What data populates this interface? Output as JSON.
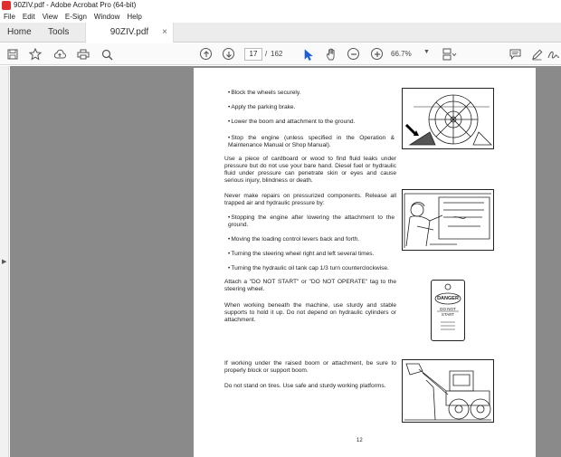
{
  "window": {
    "title": "90ZIV.pdf - Adobe Acrobat Pro (64-bit)"
  },
  "menu": [
    "File",
    "Edit",
    "View",
    "E-Sign",
    "Window",
    "Help"
  ],
  "tabs": {
    "home": "Home",
    "tools": "Tools",
    "document": "90ZIV.pdf",
    "close": "×"
  },
  "toolbar": {
    "current_page": "17",
    "page_separator": "/",
    "total_pages": "162",
    "zoom": "66.7%"
  },
  "colors": {
    "tab_bar": "#ececec",
    "document_background": "#8a8a8a",
    "app_icon": "#e02f2f"
  },
  "icons": {
    "save": "save-icon",
    "bookmark": "star-icon",
    "upload": "cloud-upload-icon",
    "print": "printer-icon",
    "find": "magnifier-icon",
    "prev_page": "arrow-up-circle-icon",
    "next_page": "arrow-down-circle-icon",
    "select": "cursor-arrow-icon",
    "hand": "hand-icon",
    "zoom_out": "minus-circle-icon",
    "zoom_in": "plus-circle-icon",
    "page_display": "page-layout-icon",
    "comment": "comment-icon",
    "edit": "pencil-icon",
    "sign": "signature-icon"
  },
  "document": {
    "items": [
      "Block the wheels securely.",
      "Apply the parking brake.",
      "Lower the boom and attachment to the ground.",
      "Stop the engine (unless specified in the Operation & Maintenance Manual or Shop Manual).",
      "Use a piece of cardboard or wood to find fluid leaks under pressure but do not use your bare hand.  Diesel fuel or hydraulic fluid under pressure can penetrate skin or eyes and cause serious injury, blindness or death.",
      "Never make repairs on pressurized components.  Release all trapped air and hydraulic pressure by:",
      "Stopping the engine after lowering the attachment to the ground.",
      "Moving the loading control levers back and forth.",
      "Turning the steering wheel right and left several times.",
      "Turning the hydraulic oil tank cap 1/3 turn counterclockwise.",
      "Attach a \"DO NOT START\" or \"DO NOT OPERATE\" tag to the steering wheel.",
      "When working beneath the machine, use sturdy and stable supports to hold it up.  Do not depend on hydraulic cylinders or attachment.",
      "If working under the raised boom or attachment, be sure to properly block or support boom.",
      "Do not stand on tires.  Use safe and sturdy working platforms."
    ],
    "tag": {
      "heading": "DANGER",
      "line1": "DO NOT",
      "line2": "START"
    },
    "page_number": "12"
  }
}
